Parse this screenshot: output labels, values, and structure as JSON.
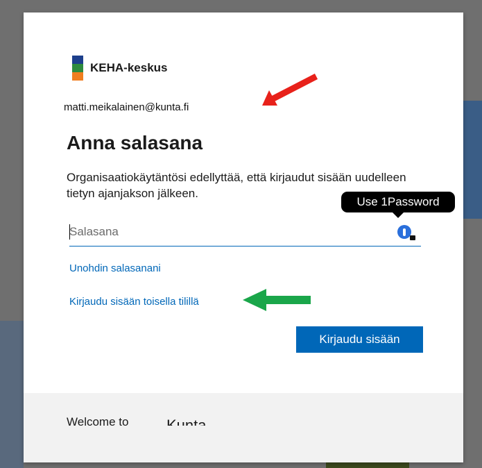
{
  "logo": {
    "name": "KEHA-keskus",
    "colors": [
      "#1d3f8c",
      "#2e8b3e",
      "#f07e1f"
    ]
  },
  "account": {
    "email": "matti.meikalainen@kunta.fi"
  },
  "heading": "Anna salasana",
  "description": "Organisaatiokäytäntösi edellyttää, että kirjaudut sisään uudelleen tietyn ajanjakson jälkeen.",
  "password": {
    "placeholder": "Salasana",
    "value": ""
  },
  "password_manager": {
    "tooltip": "Use 1Password",
    "icon": "1password-icon"
  },
  "links": {
    "forgot": "Unohdin salasanani",
    "other_account": "Kirjaudu sisään toisella tilillä"
  },
  "buttons": {
    "sign_in": "Kirjaudu sisään"
  },
  "footer": {
    "welcome": "Welcome to",
    "brand": "Kunta"
  },
  "annotations": {
    "red_arrow_color": "#e8211a",
    "green_arrow_color": "#1aa64a"
  },
  "accent_color": "#0067b8"
}
